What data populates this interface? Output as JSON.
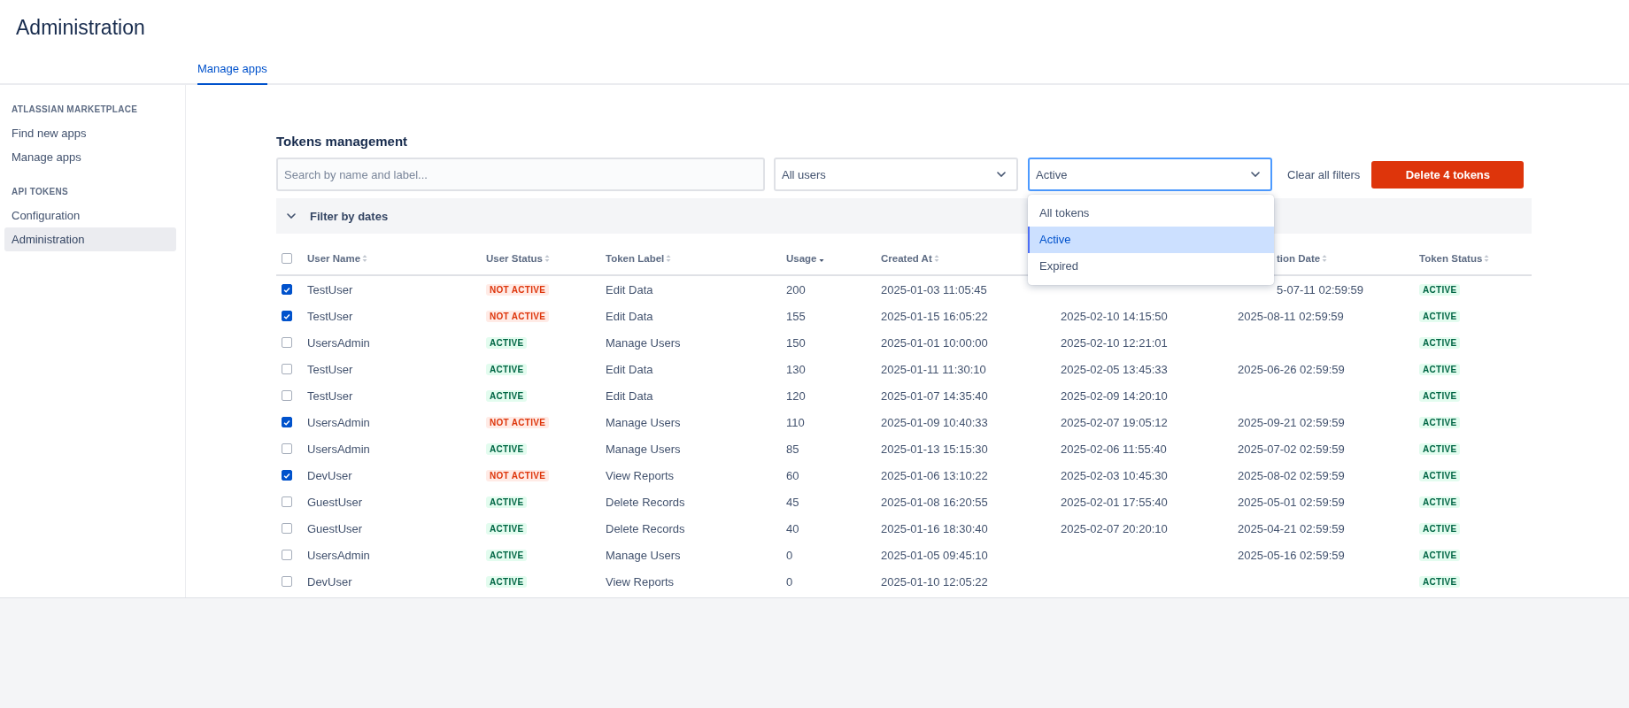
{
  "page": {
    "title": "Administration"
  },
  "tabs": [
    {
      "label": "Manage apps",
      "selected": true
    }
  ],
  "sidebar": {
    "sections": [
      {
        "heading": "ATLASSIAN MARKETPLACE",
        "items": [
          {
            "label": "Find new apps",
            "selected": false
          },
          {
            "label": "Manage apps",
            "selected": false
          }
        ]
      },
      {
        "heading": "API TOKENS",
        "items": [
          {
            "label": "Configuration",
            "selected": false
          },
          {
            "label": "Administration",
            "selected": true
          }
        ]
      }
    ]
  },
  "tokens": {
    "title": "Tokens management",
    "search": {
      "placeholder": "Search by name and label..."
    },
    "user_filter": {
      "value": "All users"
    },
    "status_filter": {
      "value": "Active",
      "open": true,
      "options": [
        {
          "label": "All tokens",
          "selected": false
        },
        {
          "label": "Active",
          "selected": true
        },
        {
          "label": "Expired",
          "selected": false
        }
      ]
    },
    "clear_filters": "Clear all filters",
    "delete_button": "Delete 4 tokens",
    "date_filter": {
      "label": "Filter by dates",
      "expanded": false
    },
    "table": {
      "all_checked": false,
      "columns": [
        {
          "label": "User Name",
          "sorted": false
        },
        {
          "label": "User Status",
          "sorted": false
        },
        {
          "label": "Token Label",
          "sorted": false
        },
        {
          "label": "Usage",
          "sorted": true
        },
        {
          "label": "Created At",
          "sorted": false
        },
        null,
        {
          "label": "tion Date",
          "sorted": false
        },
        {
          "label": "Token Status",
          "sorted": false
        }
      ],
      "rows": [
        {
          "selected": true,
          "cells": [
            "TestUser",
            {
              "text": "NOT ACTIVE",
              "kind": "inactive"
            },
            "Edit Data",
            "200",
            "2025-01-03 11:05:45",
            null,
            "5-07-11 02:59:59",
            {
              "text": "ACTIVE",
              "kind": "active"
            }
          ]
        },
        {
          "selected": true,
          "cells": [
            "TestUser",
            {
              "text": "NOT ACTIVE",
              "kind": "inactive"
            },
            "Edit Data",
            "155",
            "2025-01-15 16:05:22",
            "2025-02-10 14:15:50",
            "2025-08-11 02:59:59",
            {
              "text": "ACTIVE",
              "kind": "active"
            }
          ]
        },
        {
          "selected": false,
          "cells": [
            "UsersAdmin",
            {
              "text": "ACTIVE",
              "kind": "active"
            },
            "Manage Users",
            "150",
            "2025-01-01 10:00:00",
            "2025-02-10 12:21:01",
            null,
            {
              "text": "ACTIVE",
              "kind": "active"
            }
          ]
        },
        {
          "selected": false,
          "cells": [
            "TestUser",
            {
              "text": "ACTIVE",
              "kind": "active"
            },
            "Edit Data",
            "130",
            "2025-01-11 11:30:10",
            "2025-02-05 13:45:33",
            "2025-06-26 02:59:59",
            {
              "text": "ACTIVE",
              "kind": "active"
            }
          ]
        },
        {
          "selected": false,
          "cells": [
            "TestUser",
            {
              "text": "ACTIVE",
              "kind": "active"
            },
            "Edit Data",
            "120",
            "2025-01-07 14:35:40",
            "2025-02-09 14:20:10",
            null,
            {
              "text": "ACTIVE",
              "kind": "active"
            }
          ]
        },
        {
          "selected": true,
          "cells": [
            "UsersAdmin",
            {
              "text": "NOT ACTIVE",
              "kind": "inactive"
            },
            "Manage Users",
            "110",
            "2025-01-09 10:40:33",
            "2025-02-07 19:05:12",
            "2025-09-21 02:59:59",
            {
              "text": "ACTIVE",
              "kind": "active"
            }
          ]
        },
        {
          "selected": false,
          "cells": [
            "UsersAdmin",
            {
              "text": "ACTIVE",
              "kind": "active"
            },
            "Manage Users",
            "85",
            "2025-01-13 15:15:30",
            "2025-02-06 11:55:40",
            "2025-07-02 02:59:59",
            {
              "text": "ACTIVE",
              "kind": "active"
            }
          ]
        },
        {
          "selected": true,
          "cells": [
            "DevUser",
            {
              "text": "NOT ACTIVE",
              "kind": "inactive"
            },
            "View Reports",
            "60",
            "2025-01-06 13:10:22",
            "2025-02-03 10:45:30",
            "2025-08-02 02:59:59",
            {
              "text": "ACTIVE",
              "kind": "active"
            }
          ]
        },
        {
          "selected": false,
          "cells": [
            "GuestUser",
            {
              "text": "ACTIVE",
              "kind": "active"
            },
            "Delete Records",
            "45",
            "2025-01-08 16:20:55",
            "2025-02-01 17:55:40",
            "2025-05-01 02:59:59",
            {
              "text": "ACTIVE",
              "kind": "active"
            }
          ]
        },
        {
          "selected": false,
          "cells": [
            "GuestUser",
            {
              "text": "ACTIVE",
              "kind": "active"
            },
            "Delete Records",
            "40",
            "2025-01-16 18:30:40",
            "2025-02-07 20:20:10",
            "2025-04-21 02:59:59",
            {
              "text": "ACTIVE",
              "kind": "active"
            }
          ]
        },
        {
          "selected": false,
          "cells": [
            "UsersAdmin",
            {
              "text": "ACTIVE",
              "kind": "active"
            },
            "Manage Users",
            "0",
            "2025-01-05 09:45:10",
            null,
            "2025-05-16 02:59:59",
            {
              "text": "ACTIVE",
              "kind": "active"
            }
          ]
        },
        {
          "selected": false,
          "cells": [
            "DevUser",
            {
              "text": "ACTIVE",
              "kind": "active"
            },
            "View Reports",
            "0",
            "2025-01-10 12:05:22",
            null,
            null,
            {
              "text": "ACTIVE",
              "kind": "active"
            }
          ]
        }
      ]
    }
  }
}
